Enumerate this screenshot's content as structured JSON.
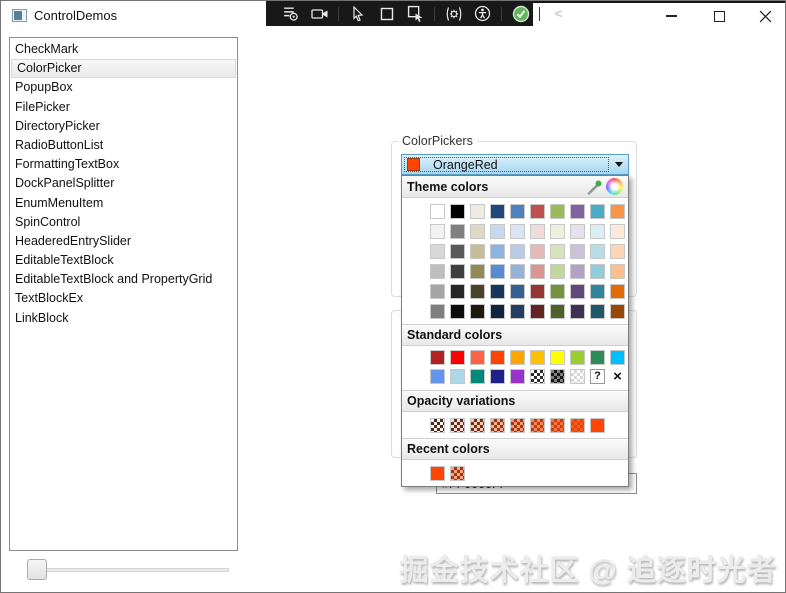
{
  "window": {
    "title": "ControlDemos",
    "controls": [
      "minimize",
      "maximize",
      "close"
    ]
  },
  "toolbar": {
    "icon_names": [
      "drag-grip",
      "element-picker",
      "record-camera",
      "cursor",
      "region-frame",
      "cursor-region",
      "settings-gear",
      "accessibility",
      "confirm-check"
    ],
    "chevron": "<"
  },
  "sidebar": {
    "items": [
      {
        "label": "CheckMark",
        "selected": false
      },
      {
        "label": "ColorPicker",
        "selected": true
      },
      {
        "label": "PopupBox",
        "selected": false
      },
      {
        "label": "FilePicker",
        "selected": false
      },
      {
        "label": "DirectoryPicker",
        "selected": false
      },
      {
        "label": "RadioButtonList",
        "selected": false
      },
      {
        "label": "FormattingTextBox",
        "selected": false
      },
      {
        "label": "DockPanelSplitter",
        "selected": false
      },
      {
        "label": "EnumMenuItem",
        "selected": false
      },
      {
        "label": "SpinControl",
        "selected": false
      },
      {
        "label": "HeaderedEntrySlider",
        "selected": false
      },
      {
        "label": "EditableTextBlock",
        "selected": false
      },
      {
        "label": "EditableTextBlock and PropertyGrid",
        "selected": false
      },
      {
        "label": "TextBlockEx",
        "selected": false
      },
      {
        "label": "LinkBlock",
        "selected": false
      }
    ]
  },
  "colorpicker": {
    "group_label": "ColorPickers",
    "combo": {
      "value": "OrangeRed",
      "swatch": "#FF4500"
    },
    "hex_input": "#FF0000FF",
    "tool_icons": [
      "eyedropper-icon",
      "color-wheel-icon"
    ],
    "sections": [
      {
        "title": "Theme colors",
        "rows": [
          [
            "#FFFFFF",
            "#000000",
            "#EEECE1",
            "#1F497D",
            "#4F81BD",
            "#C0504D",
            "#9BBB59",
            "#8064A2",
            "#4BACC6",
            "#F79646"
          ],
          [
            "#F2F2F2",
            "#7F7F7F",
            "#DDD9C3",
            "#C6D9F0",
            "#DBE5F1",
            "#F2DCDB",
            "#EBF1DD",
            "#E5E0EC",
            "#DBEEF3",
            "#FDEADA"
          ],
          [
            "#D8D8D8",
            "#595959",
            "#C4BD97",
            "#8DB3E2",
            "#B8CCE4",
            "#E5B9B7",
            "#D7E3BC",
            "#CCC1D9",
            "#B7DDE8",
            "#FBD5B5"
          ],
          [
            "#BFBFBF",
            "#3F3F3F",
            "#938953",
            "#548DD4",
            "#95B3D7",
            "#D99694",
            "#C3D69B",
            "#B2A2C7",
            "#92CDDC",
            "#FAC08F"
          ],
          [
            "#A5A5A5",
            "#262626",
            "#494429",
            "#17365D",
            "#366092",
            "#943634",
            "#76923C",
            "#5F497A",
            "#31859B",
            "#E36C09"
          ],
          [
            "#7F7F7F",
            "#0C0C0C",
            "#1D1B10",
            "#0F243E",
            "#244061",
            "#632423",
            "#4F6128",
            "#3F3151",
            "#205867",
            "#974806"
          ]
        ]
      },
      {
        "title": "Standard colors",
        "rows": [
          [
            "#B22222",
            "#FF0000",
            "#FF6347",
            "#FF4500",
            "#FFA500",
            "#FFC000",
            "#FFFF00",
            "#9ACD32",
            "#2E8B57",
            "#00BFFF"
          ],
          [
            "#6495ED",
            "#ADD8E6",
            "#00897B",
            "#20208A",
            "#9932CC",
            "checker-dark",
            "alpha:#000000:0.5",
            "checker-light",
            "question",
            "none"
          ]
        ]
      },
      {
        "title": "Opacity variations",
        "rows": [
          [
            "alpha:#FF4500:0.1",
            "alpha:#FF4500:0.2",
            "alpha:#FF4500:0.3",
            "alpha:#FF4500:0.45",
            "alpha:#FF4500:0.55",
            "alpha:#FF4500:0.65",
            "alpha:#FF4500:0.75",
            "alpha:#FF4500:0.88",
            "#FF4500"
          ]
        ]
      },
      {
        "title": "Recent colors",
        "rows": [
          [
            "#FF4500",
            "alpha:#FF4500:0.5"
          ]
        ]
      }
    ]
  },
  "watermark": "掘金技术社区 @ 追逐时光者"
}
